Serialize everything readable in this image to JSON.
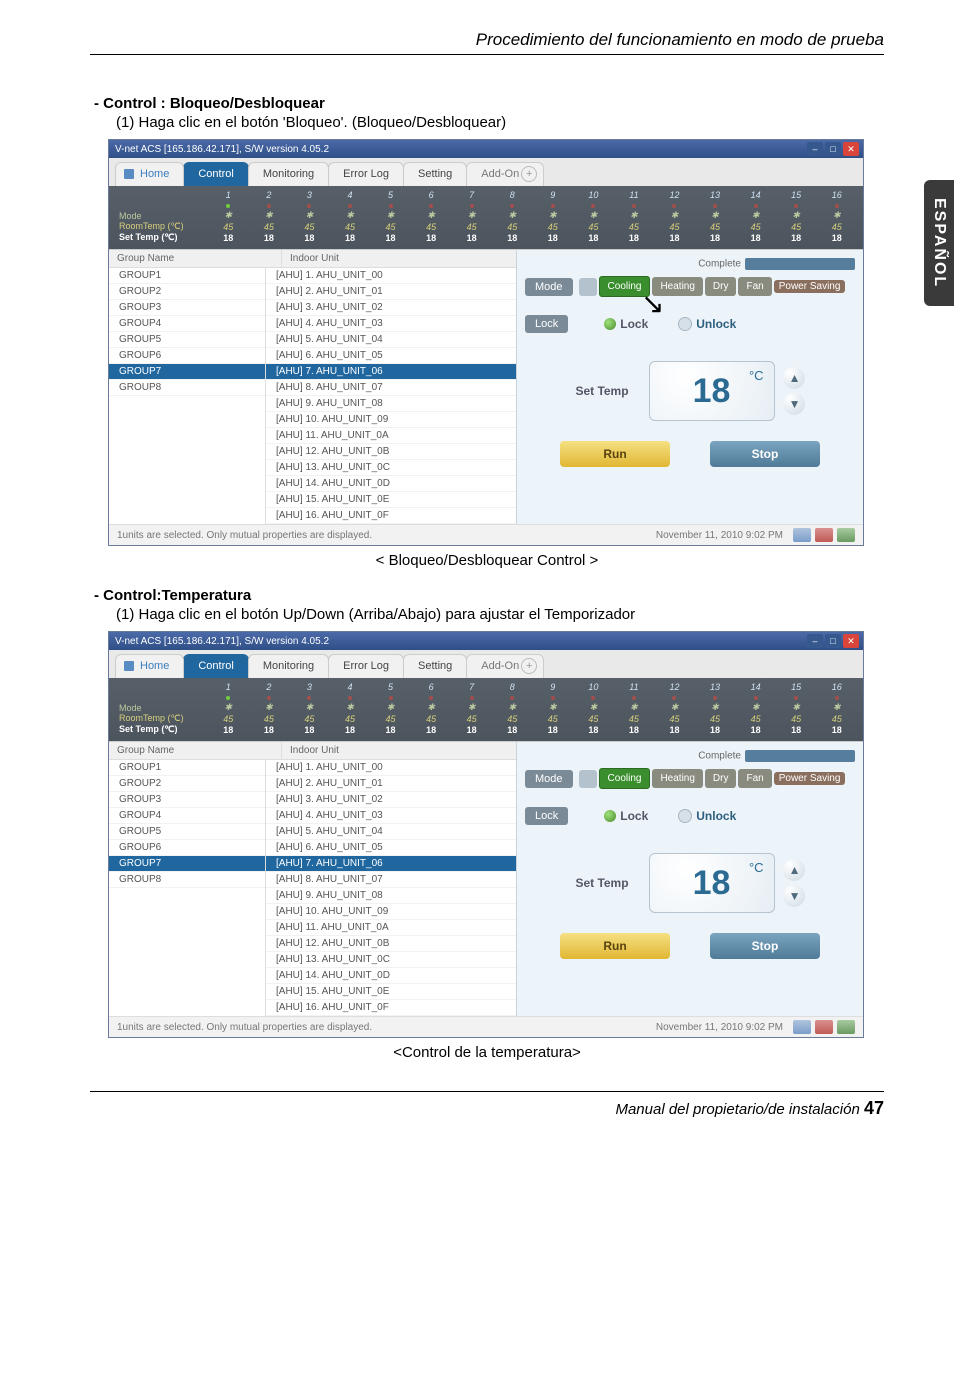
{
  "page": {
    "header": "Procedimiento del funcionamiento en modo de prueba",
    "side_tab": "ESPAÑOL",
    "footer_text": "Manual del propietario/de instalación",
    "page_number": "47"
  },
  "section1": {
    "label": "- Control : Bloqueo/Desbloquear",
    "instruction": "(1) Haga clic en el botón 'Bloqueo'. (Bloqueo/Desbloquear)",
    "caption": "< Bloqueo/Desbloquear Control >"
  },
  "section2": {
    "label": "- Control:Temperatura",
    "instruction": "(1) Haga clic en el botón Up/Down (Arriba/Abajo) para ajustar el Temporizador",
    "caption": "<Control de la temperatura>"
  },
  "app": {
    "title": "V-net ACS [165.186.42.171],  S/W version 4.05.2",
    "tabs": {
      "home": "Home",
      "control": "Control",
      "monitoring": "Monitoring",
      "errorlog": "Error Log",
      "setting": "Setting",
      "addon": "Add-On"
    },
    "strip": {
      "mode": "Mode",
      "roomtemp": "RoomTemp (℃)",
      "settemp": "Set Temp  (℃)",
      "col_nums": [
        "1",
        "2",
        "3",
        "4",
        "5",
        "6",
        "7",
        "8",
        "9",
        "10",
        "11",
        "12",
        "13",
        "14",
        "15",
        "16"
      ],
      "room_vals": [
        "45",
        "45",
        "45",
        "45",
        "45",
        "45",
        "45",
        "45",
        "45",
        "45",
        "45",
        "45",
        "45",
        "45",
        "45",
        "45"
      ],
      "set_vals": [
        "18",
        "18",
        "18",
        "18",
        "18",
        "18",
        "18",
        "18",
        "18",
        "18",
        "18",
        "18",
        "18",
        "18",
        "18",
        "18"
      ]
    },
    "columns": {
      "group": "Group Name",
      "unit": "Indoor Unit"
    },
    "groups": [
      "GROUP1",
      "GROUP2",
      "GROUP3",
      "GROUP4",
      "GROUP5",
      "GROUP6",
      "GROUP7",
      "GROUP8"
    ],
    "group_selected_index": 6,
    "units": [
      "[AHU] 1. AHU_UNIT_00",
      "[AHU] 2. AHU_UNIT_01",
      "[AHU] 3. AHU_UNIT_02",
      "[AHU] 4. AHU_UNIT_03",
      "[AHU] 5. AHU_UNIT_04",
      "[AHU] 6. AHU_UNIT_05",
      "[AHU] 7. AHU_UNIT_06",
      "[AHU] 8. AHU_UNIT_07",
      "[AHU] 9. AHU_UNIT_08",
      "[AHU] 10. AHU_UNIT_09",
      "[AHU] 11. AHU_UNIT_0A",
      "[AHU] 12. AHU_UNIT_0B",
      "[AHU] 13. AHU_UNIT_0C",
      "[AHU] 14. AHU_UNIT_0D",
      "[AHU] 15. AHU_UNIT_0E",
      "[AHU] 16. AHU_UNIT_0F"
    ],
    "unit_selected_index": 6,
    "status_left": "1units are selected. Only mutual properties are displayed.",
    "status_right": "November 11, 2010  9:02 PM",
    "panel": {
      "complete": "Complete",
      "mode": "Mode",
      "mode_opts": {
        "cooling": "Cooling",
        "heating": "Heating",
        "dry": "Dry",
        "fan": "Fan",
        "power": "Power\nSaving"
      },
      "lock": "Lock",
      "lock_opt": "Lock",
      "unlock_opt": "Unlock",
      "settemp": "Set Temp",
      "temp_value": "18",
      "temp_unit": "°C",
      "run": "Run",
      "stop": "Stop"
    }
  }
}
